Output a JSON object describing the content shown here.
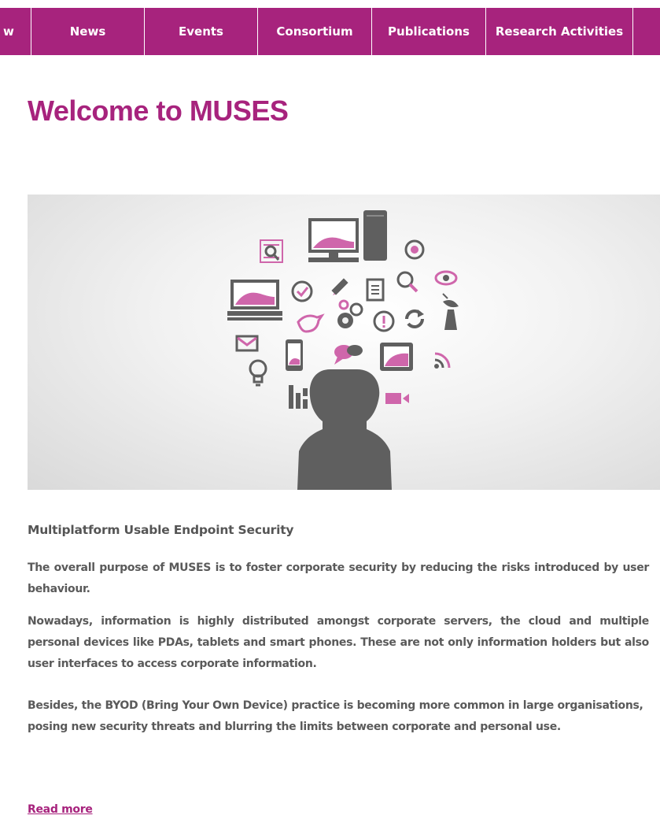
{
  "nav": {
    "items": [
      {
        "label": "w"
      },
      {
        "label": "News"
      },
      {
        "label": "Events"
      },
      {
        "label": "Consortium"
      },
      {
        "label": "Publications"
      },
      {
        "label": "Research Activities"
      },
      {
        "label": ""
      }
    ]
  },
  "page": {
    "title": "Welcome to MUSES"
  },
  "hero": {
    "icons": [
      "magnifier-document-icon",
      "desktop-computer-icon",
      "server-tower-icon",
      "target-icon",
      "laptop-icon",
      "checkmark-icon",
      "pencil-icon",
      "document-icon",
      "search-icon",
      "eye-icon",
      "gears-icon",
      "alert-icon",
      "refresh-icon",
      "satellite-dish-icon",
      "bird-icon",
      "mail-icon",
      "phone-icon",
      "chat-bubbles-icon",
      "tablet-icon",
      "wifi-icon",
      "lightbulb-icon",
      "bar-chart-icon",
      "video-camera-icon",
      "user-silhouette-icon"
    ],
    "colors": {
      "accent": "#a7237d",
      "icon": "#5f5f5f",
      "pink": "#cf66ab"
    }
  },
  "article": {
    "subtitle": "Multiplatform Usable Endpoint Security",
    "paragraphs": [
      "The overall purpose of MUSES is to foster corporate security by reducing the risks introduced by user behaviour.",
      "Nowadays, information is highly distributed amongst corporate servers, the cloud and multiple personal devices like PDAs, tablets and smart phones. These are not only information holders but also user interfaces to access corporate information.",
      "Besides, the BYOD (Bring Your Own Device) practice is becoming more common in large organisations, posing new security threats and blurring the limits between corporate and personal use."
    ],
    "read_more": "Read more"
  }
}
